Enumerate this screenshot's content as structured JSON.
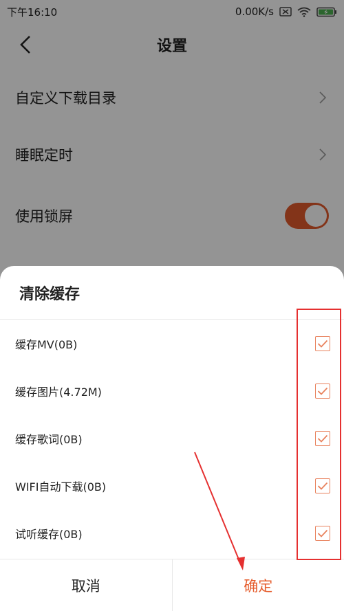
{
  "status_bar": {
    "time": "下午16:10",
    "network_speed": "0.00K/s",
    "icons": [
      "sim-blocked-icon",
      "wifi-icon",
      "battery-charging-icon"
    ]
  },
  "header": {
    "title": "设置",
    "back_icon": "chevron-left-icon"
  },
  "settings": {
    "items": [
      {
        "label": "自定义下载目录",
        "control": "chevron-right-icon"
      },
      {
        "label": "睡眠定时",
        "control": "chevron-right-icon"
      },
      {
        "label": "使用锁屏",
        "control": "toggle",
        "toggle_on": true
      }
    ]
  },
  "sheet": {
    "title": "清除缓存",
    "options": [
      {
        "label": "缓存MV(0B)",
        "checked": true
      },
      {
        "label": "缓存图片(4.72M)",
        "checked": true
      },
      {
        "label": "缓存歌词(0B)",
        "checked": true
      },
      {
        "label": "WIFI自动下载(0B)",
        "checked": true
      },
      {
        "label": "试听缓存(0B)",
        "checked": true
      }
    ],
    "cancel_label": "取消",
    "confirm_label": "确定"
  },
  "colors": {
    "accent": "#e55d2d",
    "checkbox": "#e8805b",
    "annotation": "#e53030"
  }
}
